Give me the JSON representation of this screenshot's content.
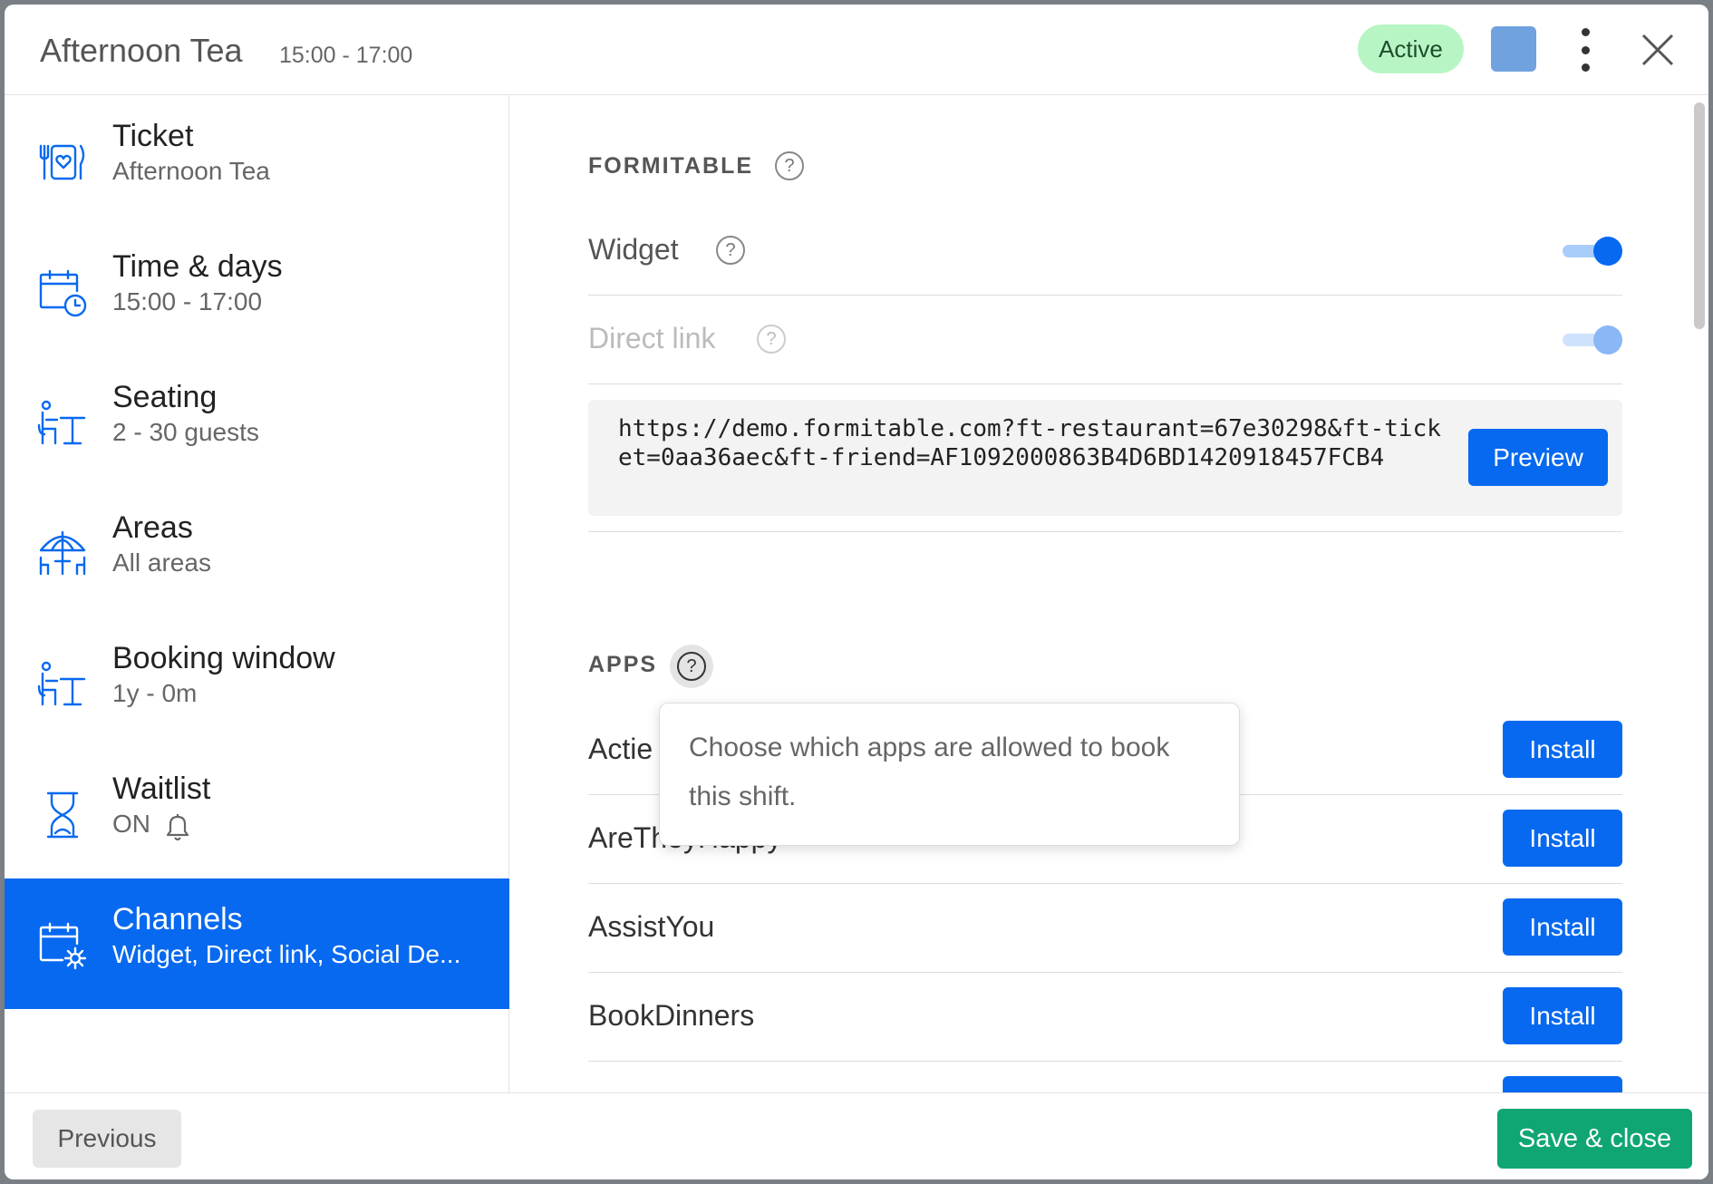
{
  "header": {
    "title": "Afternoon Tea",
    "time_range": "15:00 - 17:00",
    "status_badge": "Active",
    "color": "#6fa2de"
  },
  "sidebar": {
    "items": [
      {
        "title": "Ticket",
        "subtitle": "Afternoon Tea",
        "icon": "ticket-dinner-icon"
      },
      {
        "title": "Time & days",
        "subtitle": "15:00 - 17:00",
        "icon": "calendar-clock-icon"
      },
      {
        "title": "Seating",
        "subtitle": "2 - 30 guests",
        "icon": "seating-icon"
      },
      {
        "title": "Areas",
        "subtitle": "All areas",
        "icon": "parasol-icon"
      },
      {
        "title": "Booking window",
        "subtitle": "1y - 0m",
        "icon": "seating-icon"
      },
      {
        "title": "Waitlist",
        "subtitle": "ON",
        "icon": "hourglass-icon"
      },
      {
        "title": "Channels",
        "subtitle": "Widget, Direct link, Social De...",
        "icon": "calendar-gear-icon",
        "active": true
      }
    ]
  },
  "main": {
    "formitable_heading": "FORMITABLE",
    "widget_label": "Widget",
    "widget_enabled": true,
    "direct_link_label": "Direct link",
    "direct_link_enabled": true,
    "direct_link_url": "https://demo.formitable.com?ft-restaurant=67e30298&ft-ticket=0aa36aec&ft-friend=AF1092000863B4D6BD1420918457FCB4",
    "preview_label": "Preview",
    "apps_heading": "APPS",
    "apps_tooltip": "Choose which apps are allowed to book this shift.",
    "apps": [
      {
        "name": "Actie",
        "action": "Install"
      },
      {
        "name": "AreTheyHappy",
        "action": "Install"
      },
      {
        "name": "AssistYou",
        "action": "Install"
      },
      {
        "name": "BookDinners",
        "action": "Install"
      }
    ]
  },
  "footer": {
    "previous_label": "Previous",
    "save_label": "Save & close"
  },
  "colors": {
    "accent": "#0769f0",
    "save": "#0fa673",
    "badge_bg": "#b8f5c4"
  }
}
